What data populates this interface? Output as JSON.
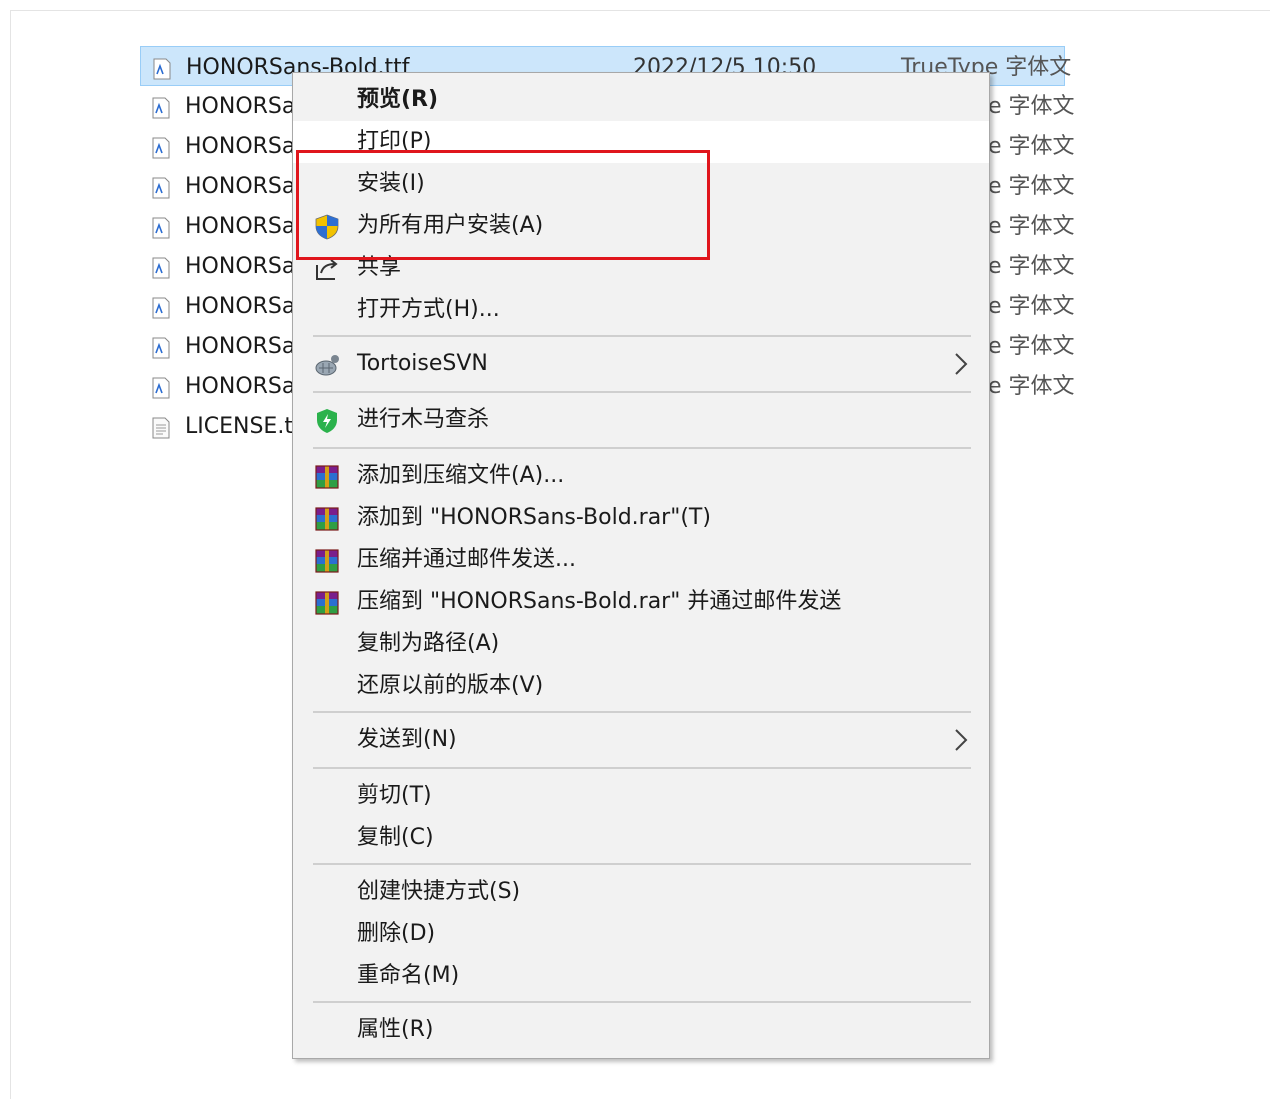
{
  "files": {
    "selected": {
      "name": "HONORSans-Bold.ttf",
      "date": "2022/12/5 10:50",
      "type": "TrueType 字体文"
    },
    "rows": [
      {
        "name": "HONORSa",
        "type": "e 字体文"
      },
      {
        "name": "HONORSa",
        "type": "e 字体文"
      },
      {
        "name": "HONORSa",
        "type": "e 字体文"
      },
      {
        "name": "HONORSa",
        "type": "e 字体文"
      },
      {
        "name": "HONORSa",
        "type": "e 字体文"
      },
      {
        "name": "HONORSa",
        "type": "e 字体文"
      },
      {
        "name": "HONORSa",
        "type": "e 字体文"
      },
      {
        "name": "HONORSa",
        "type": "e 字体文"
      }
    ],
    "license": {
      "name": "LICENSE.tx"
    }
  },
  "menu": {
    "preview": "预览(R)",
    "print": "打印(P)",
    "install": "安装(I)",
    "install_all_users": "为所有用户安装(A)",
    "share": "共享",
    "open_with": "打开方式(H)...",
    "tortoisesvn": "TortoiseSVN",
    "virus_scan": "进行木马查杀",
    "add_to_archive": "添加到压缩文件(A)...",
    "add_to_rar": "添加到 \"HONORSans-Bold.rar\"(T)",
    "compress_email": "压缩并通过邮件发送...",
    "compress_rar_email": "压缩到 \"HONORSans-Bold.rar\" 并通过邮件发送",
    "copy_as_path": "复制为路径(A)",
    "restore_versions": "还原以前的版本(V)",
    "send_to": "发送到(N)",
    "cut": "剪切(T)",
    "copy": "复制(C)",
    "create_shortcut": "创建快捷方式(S)",
    "delete": "删除(D)",
    "rename": "重命名(M)",
    "properties": "属性(R)"
  },
  "colors": {
    "selection": "#cce6fb",
    "highlight_box": "#e0151c",
    "menu_bg": "#f2f2f2"
  },
  "icons": {
    "font_file": "font-file-icon",
    "text_file": "text-file-icon",
    "uac_shield": "uac-shield-icon",
    "share": "share-icon",
    "tortoisesvn": "tortoisesvn-icon",
    "virus_scan": "antivirus-shield-icon",
    "winrar": "winrar-icon",
    "submenu": "chevron-right-icon"
  }
}
